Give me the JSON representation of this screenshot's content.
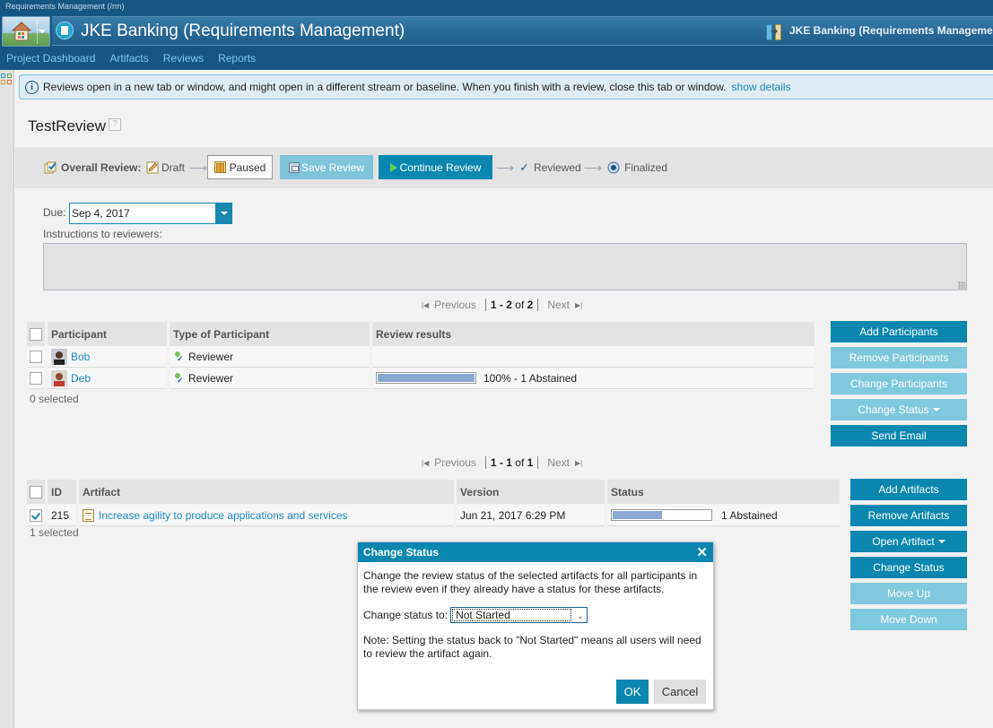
{
  "app": {
    "caption": "Requirements Management (/rm)",
    "title": "JKE Banking (Requirements Management)",
    "title_right": "JKE Banking (Requirements Management)"
  },
  "nav": [
    "Project Dashboard",
    "Artifacts",
    "Reviews",
    "Reports"
  ],
  "banner": {
    "text": "Reviews open in a new tab or window, and might open in a different stream or baseline. When you finish with a review, close this tab or window.",
    "link": "show details"
  },
  "page_title": "TestReview",
  "help_icon": "?",
  "workflow": {
    "label": "Overall Review:",
    "draft": "Draft",
    "paused": "Paused",
    "save": "Save Review",
    "continue": "Continue Review",
    "reviewed": "Reviewed",
    "finalized": "Finalized",
    "arrow": "⟶"
  },
  "due": {
    "label": "Due:",
    "value": "Sep 4, 2017"
  },
  "instructions": {
    "label": "Instructions to reviewers:",
    "value": ""
  },
  "participants": {
    "pager": {
      "previous": "Previous",
      "range": "1 - 2",
      "of": "of",
      "total": "2",
      "next": "Next"
    },
    "headers": [
      "Participant",
      "Type of Participant",
      "Review results"
    ],
    "rows": [
      {
        "name": "Bob",
        "type": "Reviewer",
        "result": "",
        "progress": null
      },
      {
        "name": "Deb",
        "type": "Reviewer",
        "result": "100% - 1 Abstained",
        "progress": 1.0
      }
    ],
    "selected": "0 selected",
    "buttons": [
      {
        "label": "Add Participants",
        "enabled": true
      },
      {
        "label": "Remove Participants",
        "enabled": false
      },
      {
        "label": "Change Participants",
        "enabled": false
      },
      {
        "label": "Change Status",
        "enabled": false,
        "dropdown": true
      },
      {
        "label": "Send Email",
        "enabled": true
      }
    ]
  },
  "artifacts": {
    "pager": {
      "previous": "Previous",
      "range": "1 - 1",
      "of": "of",
      "total": "1",
      "next": "Next"
    },
    "headers": [
      "ID",
      "Artifact",
      "Version",
      "Status"
    ],
    "rows": [
      {
        "checked": true,
        "id": "215",
        "artifact": "Increase agility to produce applications and services",
        "version": "Jun 21, 2017 6:29 PM",
        "status": "1 Abstained",
        "progress": 0.5
      }
    ],
    "selected": "1 selected",
    "buttons": [
      {
        "label": "Add Artifacts",
        "enabled": true
      },
      {
        "label": "Remove Artifacts",
        "enabled": true
      },
      {
        "label": "Open Artifact",
        "enabled": true,
        "dropdown": true
      },
      {
        "label": "Change Status",
        "enabled": true
      },
      {
        "label": "Move Up",
        "enabled": false
      },
      {
        "label": "Move Down",
        "enabled": false
      }
    ]
  },
  "dialog": {
    "title": "Change Status",
    "description": "Change the review status of the selected artifacts for all participants in the review even if they already have a status for these artifacts.",
    "field_label": "Change status to:",
    "selected_option": "Not Started",
    "note": "Note: Setting the status back to \"Not Started\" means all users will need to review the artifact again.",
    "ok": "OK",
    "cancel": "Cancel",
    "close": "✕"
  },
  "colors": {
    "accent": "#0a87b0",
    "accent_disabled": "#80c8de",
    "header_bg": "#175583",
    "link": "#1b8ac2",
    "progress": "#8aa9d2"
  }
}
